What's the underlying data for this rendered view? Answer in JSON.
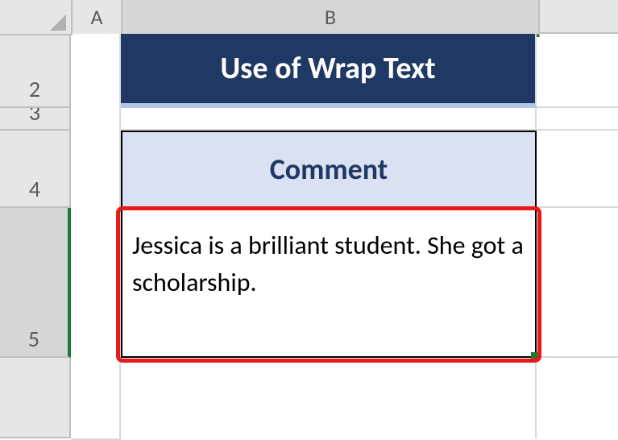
{
  "columns": {
    "A": "A",
    "B": "B"
  },
  "rows": {
    "r2": "2",
    "r3": "3",
    "r4": "4",
    "r5": "5"
  },
  "cells": {
    "B2": "Use of Wrap Text",
    "B4": "Comment",
    "B5": "Jessica is a brilliant student. She got a scholarship."
  },
  "colors": {
    "title_bg": "#1f3864",
    "title_underline": "#b4c6e7",
    "header_bg": "#d9e1f2",
    "header_text": "#1f3864",
    "highlight": "#e71a1a",
    "selection_green": "#1f7a3a"
  }
}
